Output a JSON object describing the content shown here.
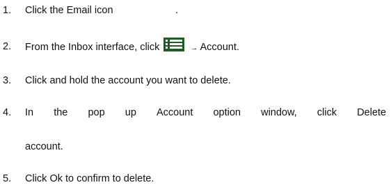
{
  "steps": [
    {
      "num": "1.",
      "text": "Click the Email icon",
      "suffix": "."
    },
    {
      "num": "2.",
      "text_before": "From the Inbox interface, click",
      "arrow": "→",
      "text_after": "Account."
    },
    {
      "num": "3.",
      "text": "Click and hold the account you want to delete."
    },
    {
      "num": "4.",
      "words": [
        "In",
        "the",
        "pop",
        "up",
        "Account",
        "option",
        "window,",
        "click",
        "Delete"
      ],
      "continuation": "account."
    },
    {
      "num": "5.",
      "text": "Click Ok to confirm to delete."
    }
  ],
  "icons": {
    "email": "email-icon (blank in image)",
    "menu": "menu-icon"
  },
  "colors": {
    "menu_icon_bg": "#1d5d22",
    "text": "#111111"
  }
}
